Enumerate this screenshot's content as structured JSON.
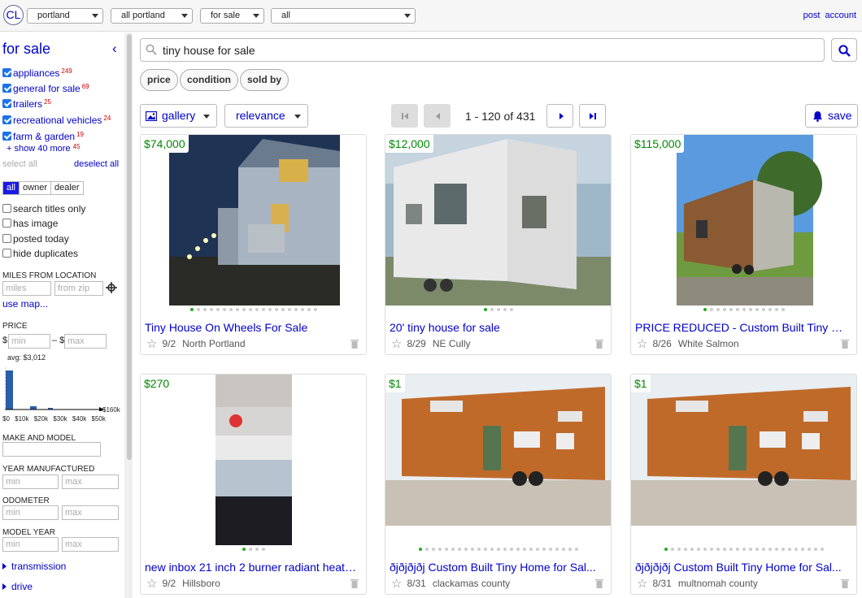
{
  "header": {
    "logo": "CL",
    "selects": [
      "portland",
      "all portland",
      "for sale",
      "all"
    ],
    "links": [
      "post",
      "account"
    ]
  },
  "sidebar": {
    "title": "for sale",
    "categories": [
      {
        "label": "appliances",
        "count": "249"
      },
      {
        "label": "general for sale",
        "count": "69"
      },
      {
        "label": "trailers",
        "count": "25"
      },
      {
        "label": "recreational vehicles",
        "count": "24"
      },
      {
        "label": "farm & garden",
        "count": "19"
      }
    ],
    "show_more": {
      "label": "+ show 40 more",
      "count": "45"
    },
    "select_all": "select all",
    "deselect_all": "deselect all",
    "seller_types": [
      "all",
      "owner",
      "dealer"
    ],
    "options": [
      "search titles only",
      "has image",
      "posted today",
      "hide duplicates"
    ],
    "miles_heading": "MILES FROM LOCATION",
    "miles_placeholder": "miles",
    "zip_placeholder": "from zip",
    "use_map": "use map...",
    "price_heading": "PRICE",
    "currency": "$",
    "price_min_placeholder": "min",
    "price_sep": "– $",
    "price_max_placeholder": "max",
    "avg": "avg: $3,012",
    "hist_axis": [
      "$0",
      "$10k",
      "$20k",
      "$30k",
      "$40k",
      "$50k"
    ],
    "hist_max": "$160k",
    "make_model_heading": "MAKE AND MODEL",
    "year_heading": "YEAR MANUFACTURED",
    "odometer_heading": "ODOMETER",
    "model_year_heading": "MODEL YEAR",
    "min_placeholder": "min",
    "max_placeholder": "max",
    "expanders": [
      "transmission",
      "drive"
    ]
  },
  "search": {
    "value": "tiny house for sale"
  },
  "filters": [
    "price",
    "condition",
    "sold by"
  ],
  "toolbar": {
    "view": "gallery",
    "sort": "relevance",
    "pagination": "1 - 120 of 431",
    "save": "save"
  },
  "listings": [
    {
      "price": "$74,000",
      "title": "Tiny House On Wheels For Sale",
      "date": "9/2",
      "location": "North Portland",
      "dots": 20,
      "active_dot": 0
    },
    {
      "price": "$12,000",
      "title": "20' tiny house for sale",
      "date": "8/29",
      "location": "NE Cully",
      "dots": 5,
      "active_dot": 0
    },
    {
      "price": "$115,000",
      "title": "PRICE REDUCED - Custom Built Tiny Ho...",
      "date": "8/26",
      "location": "White Salmon",
      "dots": 13,
      "active_dot": 0
    },
    {
      "price": "$270",
      "title": "new inbox 21 inch 2 burner radiant heater ...",
      "date": "9/2",
      "location": "Hillsboro",
      "dots": 4,
      "active_dot": 0
    },
    {
      "price": "$1",
      "title": "ðjðjðjðj Custom Built Tiny Home for Sal...",
      "date": "8/31",
      "location": "clackamas county",
      "dots": 25,
      "active_dot": 0
    },
    {
      "price": "$1",
      "title": "ðjðjðjðj Custom Built Tiny Home for Sal...",
      "date": "8/31",
      "location": "multnomah county",
      "dots": 25,
      "active_dot": 0
    }
  ],
  "colors": {
    "link": "#0000cc",
    "price": "#008800",
    "count": "#cc0000",
    "accent": "#1a1ae6"
  }
}
